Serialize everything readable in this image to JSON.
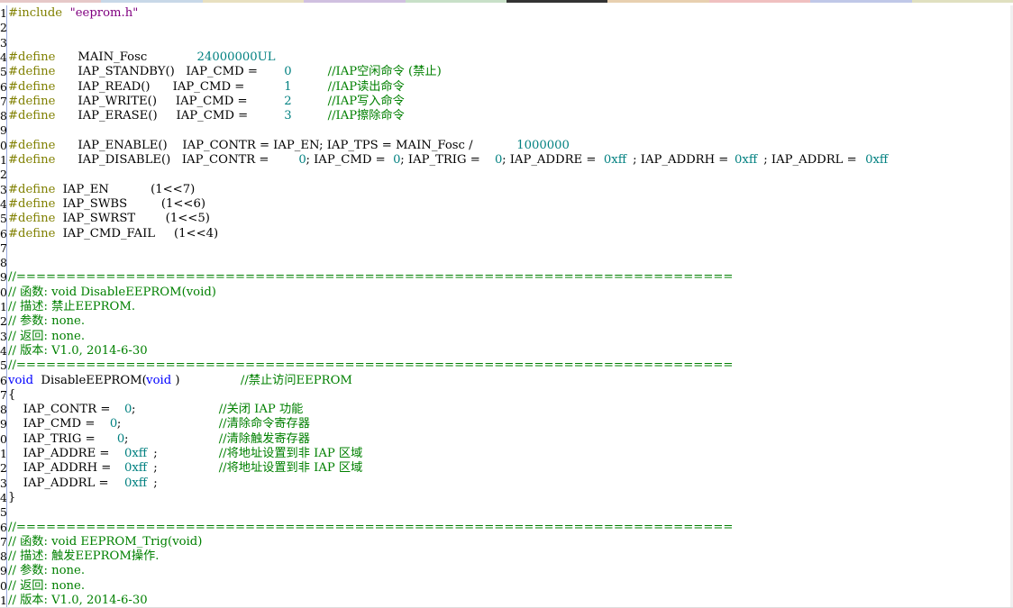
{
  "tab_colors": [
    "#e6c8c8",
    "#c8d8e8",
    "#e8e0c0",
    "#d0c0e0",
    "#c8e0c8",
    "#333333",
    "#e8d0b0",
    "#f0c0c0",
    "#c0c8e8",
    "#e0e0c0"
  ],
  "colors": {
    "preprocessor": "#808000",
    "keyword": "#0000ff",
    "string": "#800080",
    "number": "#008080",
    "comment": "#008000"
  },
  "line_numbers": [
    "1",
    "2",
    "3",
    "4",
    "5",
    "6",
    "7",
    "8",
    "9",
    "0",
    "1",
    "2",
    "3",
    "4",
    "5",
    "6",
    "7",
    "8",
    "9",
    "0",
    "1",
    "2",
    "3",
    "4",
    "5",
    "6",
    "7",
    "8",
    "9",
    "0",
    "1",
    "2",
    "3",
    "4",
    "5",
    "6",
    "7",
    "8",
    "9",
    "0",
    "1"
  ],
  "code_lines": [
    [
      {
        "t": "#include",
        "c": "kw-pre"
      },
      {
        "t": " \"eeprom.h\"",
        "c": "str"
      }
    ],
    [],
    [],
    [
      {
        "t": "#define",
        "c": "kw-pre"
      },
      {
        "t": "     MAIN_Fosc     ",
        "c": "plain"
      },
      {
        "t": "24000000UL",
        "c": "num"
      }
    ],
    [
      {
        "t": "#define",
        "c": "kw-pre"
      },
      {
        "t": "     IAP_STANDBY()   IAP_CMD = ",
        "c": "plain"
      },
      {
        "t": "0",
        "c": "num"
      },
      {
        "t": "     ",
        "c": "plain"
      },
      {
        "t": "//IAP空闲命令 (禁止)",
        "c": "cmt"
      }
    ],
    [
      {
        "t": "#define",
        "c": "kw-pre"
      },
      {
        "t": "     IAP_READ()      IAP_CMD = ",
        "c": "plain"
      },
      {
        "t": "1",
        "c": "num"
      },
      {
        "t": "     ",
        "c": "plain"
      },
      {
        "t": "//IAP读出命令",
        "c": "cmt"
      }
    ],
    [
      {
        "t": "#define",
        "c": "kw-pre"
      },
      {
        "t": "     IAP_WRITE()     IAP_CMD = ",
        "c": "plain"
      },
      {
        "t": "2",
        "c": "num"
      },
      {
        "t": "     ",
        "c": "plain"
      },
      {
        "t": "//IAP写入命令",
        "c": "cmt"
      }
    ],
    [
      {
        "t": "#define",
        "c": "kw-pre"
      },
      {
        "t": "     IAP_ERASE()     IAP_CMD = ",
        "c": "plain"
      },
      {
        "t": "3",
        "c": "num"
      },
      {
        "t": "     ",
        "c": "plain"
      },
      {
        "t": "//IAP擦除命令",
        "c": "cmt"
      }
    ],
    [],
    [
      {
        "t": "#define",
        "c": "kw-pre"
      },
      {
        "t": "     IAP_ENABLE()    IAP_CONTR = IAP_EN; IAP_TPS = MAIN_Fosc / ",
        "c": "plain"
      },
      {
        "t": "1000000",
        "c": "num"
      }
    ],
    [
      {
        "t": "#define",
        "c": "kw-pre"
      },
      {
        "t": "     IAP_DISABLE()   IAP_CONTR = ",
        "c": "plain"
      },
      {
        "t": "0",
        "c": "num"
      },
      {
        "t": "; IAP_CMD = ",
        "c": "plain"
      },
      {
        "t": "0",
        "c": "num"
      },
      {
        "t": "; IAP_TRIG = ",
        "c": "plain"
      },
      {
        "t": "0",
        "c": "num"
      },
      {
        "t": "; IAP_ADDRE = ",
        "c": "plain"
      },
      {
        "t": "0xff",
        "c": "num"
      },
      {
        "t": "; IAP_ADDRH = ",
        "c": "plain"
      },
      {
        "t": "0xff",
        "c": "num"
      },
      {
        "t": "; IAP_ADDRL = ",
        "c": "plain"
      },
      {
        "t": "0xff",
        "c": "num"
      }
    ],
    [],
    [
      {
        "t": "#define",
        "c": "kw-pre"
      },
      {
        "t": " IAP_EN           (1<<7)",
        "c": "plain"
      }
    ],
    [
      {
        "t": "#define",
        "c": "kw-pre"
      },
      {
        "t": " IAP_SWBS         (1<<6)",
        "c": "plain"
      }
    ],
    [
      {
        "t": "#define",
        "c": "kw-pre"
      },
      {
        "t": " IAP_SWRST        (1<<5)",
        "c": "plain"
      }
    ],
    [
      {
        "t": "#define",
        "c": "kw-pre"
      },
      {
        "t": " IAP_CMD_FAIL     (1<<4)",
        "c": "plain"
      }
    ],
    [],
    [],
    [
      {
        "t": "//========================================================================",
        "c": "cmt"
      }
    ],
    [
      {
        "t": "// 函数: void DisableEEPROM(void)",
        "c": "cmt"
      }
    ],
    [
      {
        "t": "// 描述: 禁止EEPROM.",
        "c": "cmt"
      }
    ],
    [
      {
        "t": "// 参数: none.",
        "c": "cmt"
      }
    ],
    [
      {
        "t": "// 返回: none.",
        "c": "cmt"
      }
    ],
    [
      {
        "t": "// 版本: V1.0, 2014-6-30",
        "c": "cmt"
      }
    ],
    [
      {
        "t": "//========================================================================",
        "c": "cmt"
      }
    ],
    [
      {
        "t": "void",
        "c": "kw"
      },
      {
        "t": " DisableEEPROM(",
        "c": "plain"
      },
      {
        "t": "void",
        "c": "kw"
      },
      {
        "t": ")        ",
        "c": "plain"
      },
      {
        "t": "//禁止访问EEPROM",
        "c": "cmt"
      }
    ],
    [
      {
        "t": "{",
        "c": "plain"
      }
    ],
    [
      {
        "t": "    IAP_CONTR = ",
        "c": "plain"
      },
      {
        "t": "0",
        "c": "num"
      },
      {
        "t": ";           ",
        "c": "plain"
      },
      {
        "t": "//关闭 IAP 功能",
        "c": "cmt"
      }
    ],
    [
      {
        "t": "    IAP_CMD = ",
        "c": "plain"
      },
      {
        "t": "0",
        "c": "num"
      },
      {
        "t": ";             ",
        "c": "plain"
      },
      {
        "t": "//清除命令寄存器",
        "c": "cmt"
      }
    ],
    [
      {
        "t": "    IAP_TRIG = ",
        "c": "plain"
      },
      {
        "t": "0",
        "c": "num"
      },
      {
        "t": ";            ",
        "c": "plain"
      },
      {
        "t": "//清除触发寄存器",
        "c": "cmt"
      }
    ],
    [
      {
        "t": "    IAP_ADDRE = ",
        "c": "plain"
      },
      {
        "t": "0xff",
        "c": "num"
      },
      {
        "t": ";        ",
        "c": "plain"
      },
      {
        "t": "//将地址设置到非 IAP 区域",
        "c": "cmt"
      }
    ],
    [
      {
        "t": "    IAP_ADDRH = ",
        "c": "plain"
      },
      {
        "t": "0xff",
        "c": "num"
      },
      {
        "t": ";        ",
        "c": "plain"
      },
      {
        "t": "//将地址设置到非 IAP 区域",
        "c": "cmt"
      }
    ],
    [
      {
        "t": "    IAP_ADDRL = ",
        "c": "plain"
      },
      {
        "t": "0xff",
        "c": "num"
      },
      {
        "t": ";",
        "c": "plain"
      }
    ],
    [
      {
        "t": "}",
        "c": "plain"
      }
    ],
    [],
    [
      {
        "t": "//========================================================================",
        "c": "cmt"
      }
    ],
    [
      {
        "t": "// 函数: void EEPROM_Trig(void)",
        "c": "cmt"
      }
    ],
    [
      {
        "t": "// 描述: 触发EEPROM操作.",
        "c": "cmt"
      }
    ],
    [
      {
        "t": "// 参数: none.",
        "c": "cmt"
      }
    ],
    [
      {
        "t": "// 返回: none.",
        "c": "cmt"
      }
    ],
    [
      {
        "t": "// 版本: V1.0, 2014-6-30",
        "c": "cmt"
      }
    ]
  ]
}
